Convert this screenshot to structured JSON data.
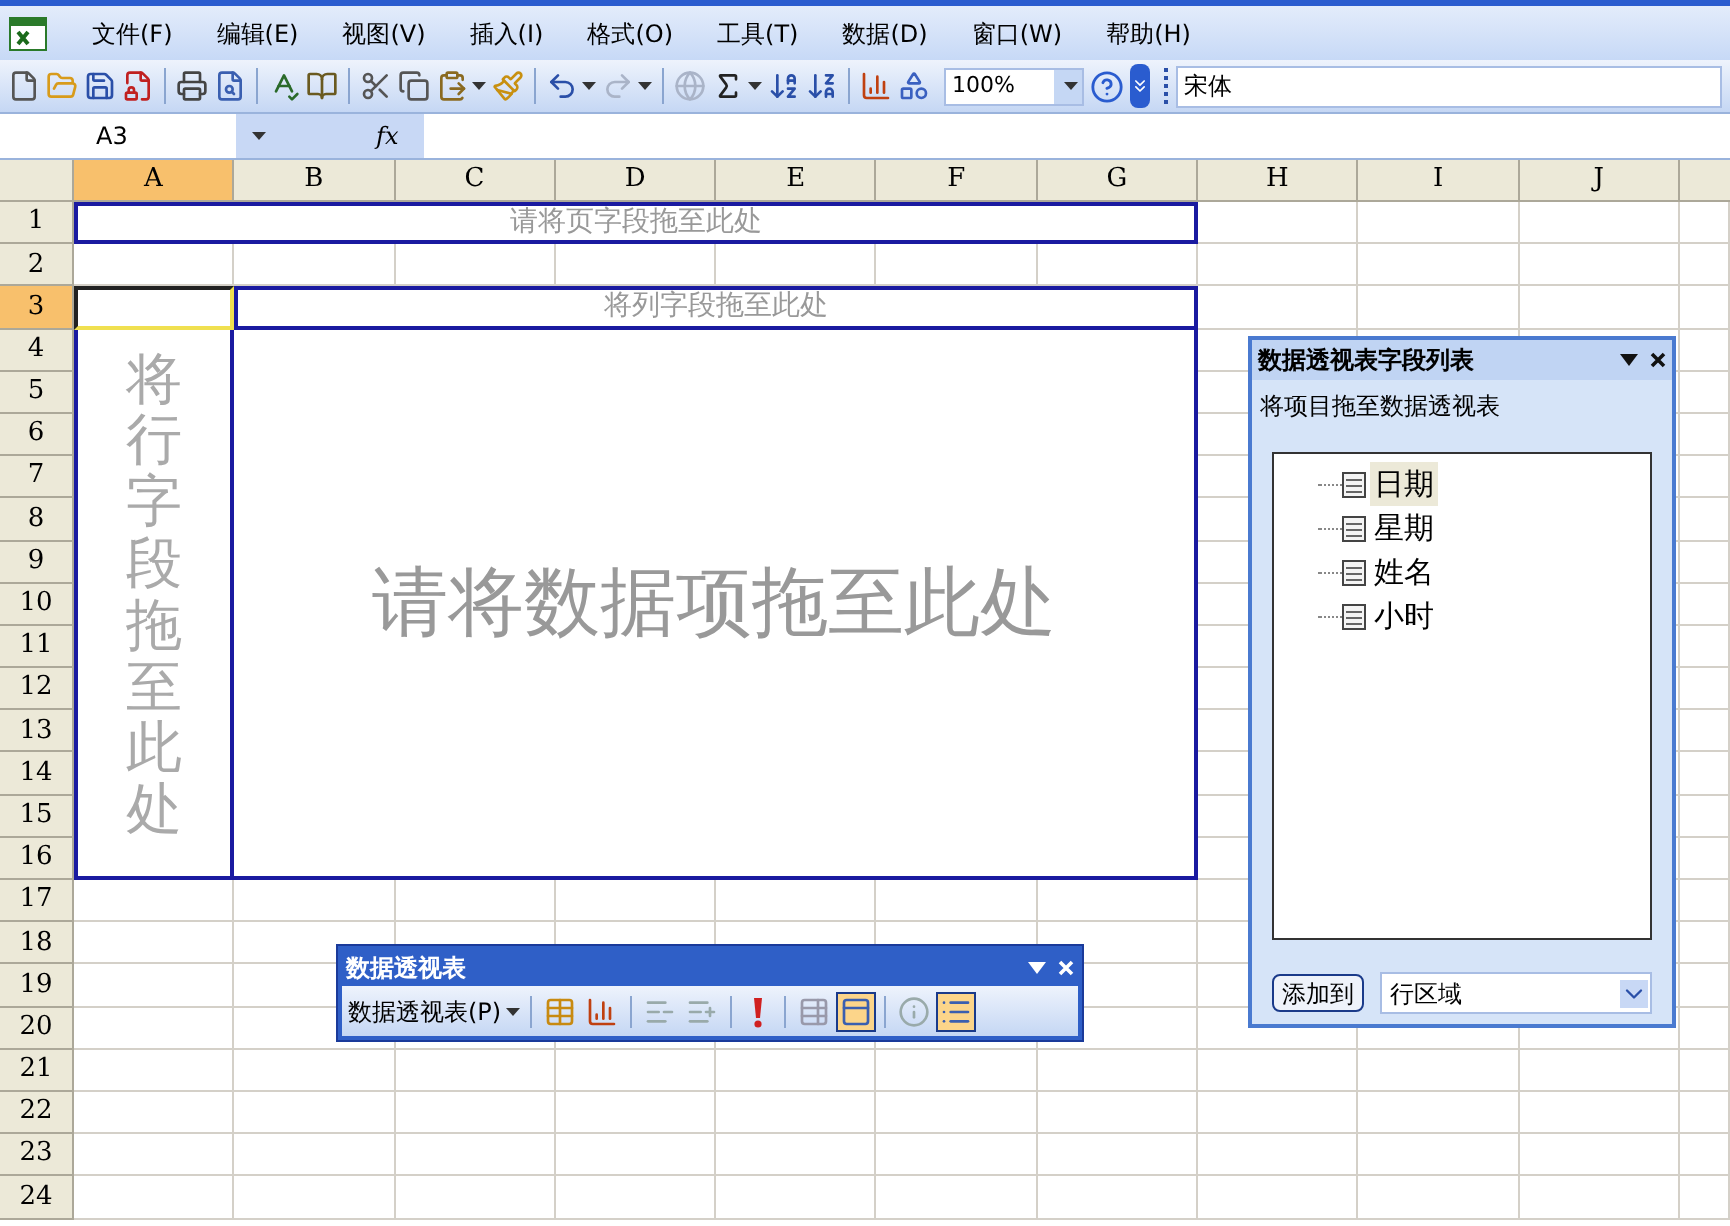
{
  "menu": [
    "文件(F)",
    "编辑(E)",
    "视图(V)",
    "插入(I)",
    "格式(O)",
    "工具(T)",
    "数据(D)",
    "窗口(W)",
    "帮助(H)"
  ],
  "toolbar": {
    "buttons": [
      {
        "kind": "new",
        "disabled": false
      },
      {
        "kind": "open",
        "disabled": false
      },
      {
        "kind": "save",
        "disabled": false
      },
      {
        "kind": "permission",
        "disabled": false
      },
      {
        "kind": "separator",
        "disabled": false
      },
      {
        "kind": "print",
        "disabled": false
      },
      {
        "kind": "preview",
        "disabled": false
      },
      {
        "kind": "separator",
        "disabled": false
      },
      {
        "kind": "spelling",
        "disabled": false
      },
      {
        "kind": "research",
        "disabled": false
      },
      {
        "kind": "separator",
        "disabled": false
      },
      {
        "kind": "cut",
        "disabled": false
      },
      {
        "kind": "copy",
        "disabled": false
      },
      {
        "kind": "paste",
        "disabled": false
      },
      {
        "kind": "painter",
        "disabled": false
      },
      {
        "kind": "separator",
        "disabled": false
      },
      {
        "kind": "undo",
        "disabled": false
      },
      {
        "kind": "redo",
        "disabled": true
      },
      {
        "kind": "separator",
        "disabled": false
      },
      {
        "kind": "hyperlink",
        "disabled": true
      },
      {
        "kind": "autosum",
        "disabled": false
      },
      {
        "kind": "sortasc",
        "disabled": false
      },
      {
        "kind": "sortdesc",
        "disabled": false
      },
      {
        "kind": "separator",
        "disabled": false
      },
      {
        "kind": "chart",
        "disabled": false
      },
      {
        "kind": "drawing",
        "disabled": false
      }
    ],
    "zoom": "100%",
    "font": "宋体"
  },
  "formula_bar": {
    "name_box": "A3",
    "fx": "fx"
  },
  "columns": [
    {
      "label": "A",
      "selected": true
    },
    {
      "label": "B",
      "selected": false
    },
    {
      "label": "C",
      "selected": false
    },
    {
      "label": "D",
      "selected": false
    },
    {
      "label": "E",
      "selected": false
    },
    {
      "label": "F",
      "selected": false
    },
    {
      "label": "G",
      "selected": false
    },
    {
      "label": "H",
      "selected": false
    },
    {
      "label": "I",
      "selected": false
    },
    {
      "label": "J",
      "selected": false
    }
  ],
  "rows": [
    {
      "label": "1",
      "selected": false
    },
    {
      "label": "2",
      "selected": false
    },
    {
      "label": "3",
      "selected": true
    },
    {
      "label": "4",
      "selected": false
    },
    {
      "label": "5",
      "selected": false
    },
    {
      "label": "6",
      "selected": false
    },
    {
      "label": "7",
      "selected": false
    },
    {
      "label": "8",
      "selected": false
    },
    {
      "label": "9",
      "selected": false
    },
    {
      "label": "10",
      "selected": false
    },
    {
      "label": "11",
      "selected": false
    },
    {
      "label": "12",
      "selected": false
    },
    {
      "label": "13",
      "selected": false
    },
    {
      "label": "14",
      "selected": false
    },
    {
      "label": "15",
      "selected": false
    },
    {
      "label": "16",
      "selected": false
    },
    {
      "label": "17",
      "selected": false
    },
    {
      "label": "18",
      "selected": false
    },
    {
      "label": "19",
      "selected": false
    },
    {
      "label": "20",
      "selected": false
    },
    {
      "label": "21",
      "selected": false
    },
    {
      "label": "22",
      "selected": false
    },
    {
      "label": "23",
      "selected": false
    },
    {
      "label": "24",
      "selected": false
    }
  ],
  "pivot_zones": {
    "page": "请将页字段拖至此处",
    "column": "将列字段拖至此处",
    "row": "将行字段拖至此处",
    "data": "请将数据项拖至此处"
  },
  "field_list": {
    "title": "数据透视表字段列表",
    "hint": "将项目拖至数据透视表",
    "fields": [
      {
        "label": "日期",
        "selected": true
      },
      {
        "label": "星期",
        "selected": false
      },
      {
        "label": "姓名",
        "selected": false
      },
      {
        "label": "小时",
        "selected": false
      }
    ],
    "add_button": "添加到",
    "area": "行区域"
  },
  "pivot_toolbar": {
    "title": "数据透视表",
    "menu": "数据透视表(P)",
    "buttons": [
      {
        "kind": "separator",
        "on": false
      },
      {
        "kind": "format",
        "on": false
      },
      {
        "kind": "chart",
        "on": false
      },
      {
        "kind": "separator",
        "on": false
      },
      {
        "kind": "hide",
        "on": false
      },
      {
        "kind": "show",
        "on": false
      },
      {
        "kind": "separator",
        "on": false
      },
      {
        "kind": "refresh",
        "on": false
      },
      {
        "kind": "separator",
        "on": false
      },
      {
        "kind": "hidden",
        "on": false
      },
      {
        "kind": "settings",
        "on": true
      },
      {
        "kind": "separator",
        "on": false
      },
      {
        "kind": "always",
        "on": false
      },
      {
        "kind": "fieldlist",
        "on": true
      }
    ]
  }
}
